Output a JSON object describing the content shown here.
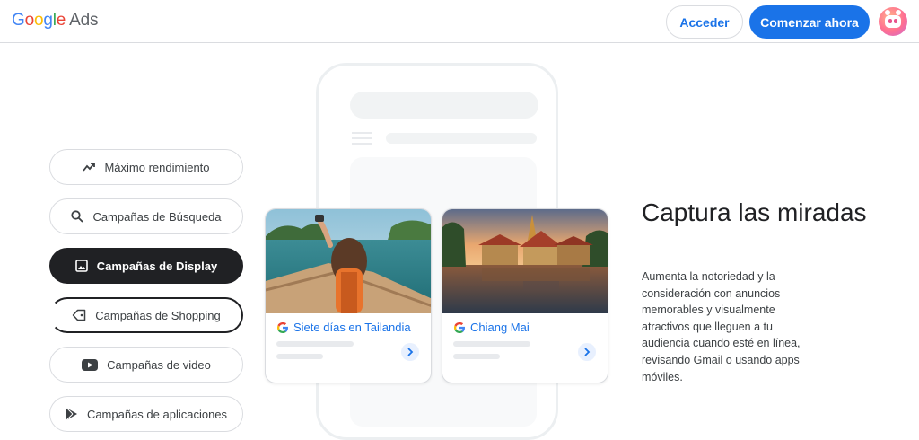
{
  "header": {
    "logo_google": [
      "G",
      "o",
      "o",
      "g",
      "l",
      "e"
    ],
    "logo_ads": "Ads",
    "login_label": "Acceder",
    "start_label": "Comenzar ahora"
  },
  "nav": {
    "items": [
      {
        "label": "Máximo rendimiento",
        "icon": "trend-icon"
      },
      {
        "label": "Campañas de Búsqueda",
        "icon": "search-icon"
      },
      {
        "label": "Campañas de Display",
        "icon": "image-icon",
        "active": true
      },
      {
        "label": "Campañas de Shopping",
        "icon": "tag-icon"
      },
      {
        "label": "Campañas de video",
        "icon": "youtube-icon"
      },
      {
        "label": "Campañas de aplicaciones",
        "icon": "play-icon"
      }
    ]
  },
  "cards": [
    {
      "title": "Siete días en Tailandia"
    },
    {
      "title": "Chiang Mai"
    }
  ],
  "hero": {
    "headline": "Captura las miradas",
    "body": "Aumenta la notoriedad y la consideración con anuncios memorables y visualmente atractivos que lleguen a tu audiencia cuando esté en línea, revisando Gmail o usando apps móviles."
  },
  "colors": {
    "primary": "#1a73e8",
    "active_nav": "#202124",
    "border": "#dadce0"
  }
}
